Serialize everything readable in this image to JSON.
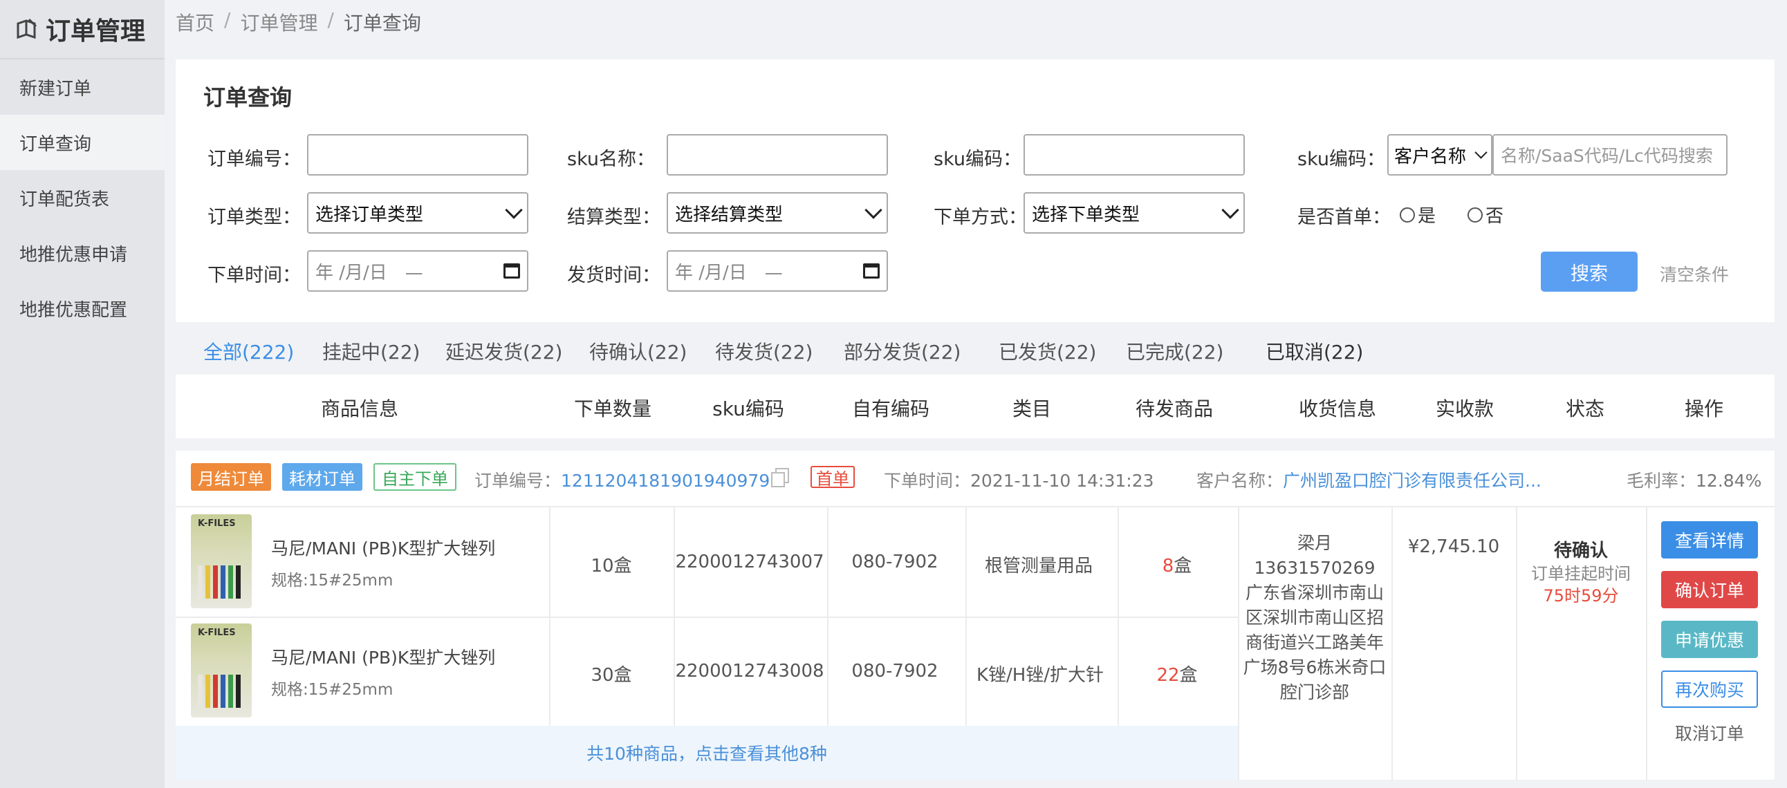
{
  "sidebar": {
    "title": "订单管理",
    "items": [
      {
        "label": "新建订单"
      },
      {
        "label": "订单查询"
      },
      {
        "label": "订单配货表"
      },
      {
        "label": "地推优惠申请"
      },
      {
        "label": "地推优惠配置"
      }
    ]
  },
  "breadcrumb": [
    "首页",
    "/",
    "订单管理",
    "/",
    "订单查询"
  ],
  "search": {
    "title": "订单查询",
    "order_no_label": "订单编号：",
    "sku_name_label": "sku名称：",
    "sku_code_label": "sku编码：",
    "sku_code2_label": "sku编码：",
    "customer_select": "客户名称",
    "customer_placeholder": "名称/SaaS代码/Lc代码搜索",
    "order_type_label": "订单类型：",
    "order_type_value": "选择订单类型",
    "settle_type_label": "结算类型：",
    "settle_type_value": "选择结算类型",
    "place_way_label": "下单方式：",
    "place_way_value": "选择下单类型",
    "first_order_label": "是否首单：",
    "first_yes": "是",
    "first_no": "否",
    "order_time_label": "下单时间：",
    "ship_time_label": "发货时间：",
    "date_placeholder": "年 /月/日　—",
    "search_button": "搜索",
    "clear_button": "清空条件"
  },
  "tabs": [
    {
      "label": "全部(222)"
    },
    {
      "label": "挂起中(22)"
    },
    {
      "label": "延迟发货(22)"
    },
    {
      "label": "待确认(22)"
    },
    {
      "label": "待发货(22)"
    },
    {
      "label": "部分发货(22)"
    },
    {
      "label": "已发货(22)"
    },
    {
      "label": "已完成(22)"
    },
    {
      "label": "已取消(22)"
    }
  ],
  "table_headers": [
    "商品信息",
    "下单数量",
    "sku编码",
    "自有编码",
    "类目",
    "待发商品",
    "收货信息",
    "实收款",
    "状态",
    "操作"
  ],
  "order": {
    "tags": [
      "月结订单",
      "耗材订单",
      "自主下单"
    ],
    "order_no_label": "订单编号：",
    "order_no": "12112041819019409797",
    "first_tag": "首单",
    "time_label": "下单时间：",
    "time": "2021-11-10 14:31:23",
    "customer_label": "客户名称：",
    "customer": "广州凯盈口腔门诊有限责任公司...",
    "margin_label": "毛利率：",
    "margin": "12.84%",
    "items": [
      {
        "name": "马尼/MANI (PB)K型扩大锉列",
        "spec": "规格:15#25mm",
        "qty": "10盒",
        "sku": "2200012743007",
        "own_code": "080-7902",
        "category": "根管测量用品",
        "pending_num": "8",
        "pending_unit": "盒"
      },
      {
        "name": "马尼/MANI (PB)K型扩大锉列",
        "spec": "规格:15#25mm",
        "qty": "30盒",
        "sku": "2200012743008",
        "own_code": "080-7902",
        "category": "K锉/H锉/扩大针",
        "pending_num": "22",
        "pending_unit": "盒"
      }
    ],
    "thumb_label": "K-FILES",
    "more_text": "共10种商品，点击查看其他8种",
    "receiver": {
      "name": "梁月",
      "phone": "13631570269",
      "address": "广东省深圳市南山区深圳市南山区招商街道兴工路美年广场8号6栋米奇口腔门诊部"
    },
    "amount": "¥2,745.10",
    "status": "待确认",
    "status_sub": "订单挂起时间",
    "status_time": "75时59分",
    "actions": {
      "detail": "查看详情",
      "confirm": "确认订单",
      "discount": "申请优惠",
      "rebuy": "再次购买",
      "cancel": "取消订单"
    }
  },
  "colors": {
    "accent": "#3b8ee6",
    "search_button": "#5b9ff3",
    "danger": "#e04848",
    "teal": "#5ab8c6",
    "sidebar_bg": "#e3e5e9"
  }
}
